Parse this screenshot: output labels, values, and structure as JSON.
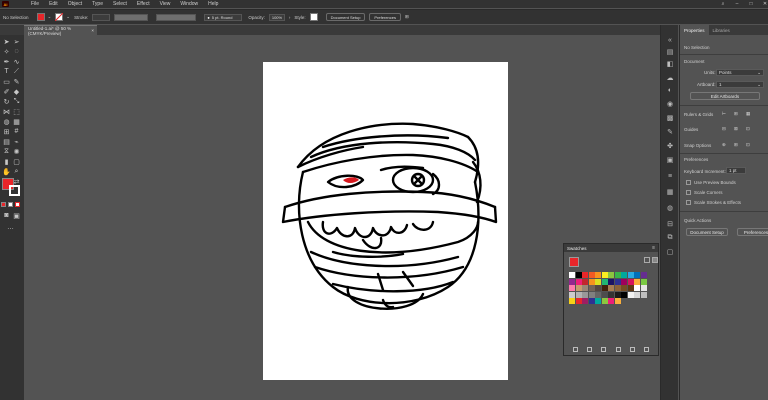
{
  "menubar": {
    "app_icon": "Ai",
    "items": [
      "File",
      "Edit",
      "Object",
      "Type",
      "Select",
      "Effect",
      "View",
      "Window",
      "Help"
    ]
  },
  "controlbar": {
    "selection_label": "No Selection",
    "stroke_label": "Stroke:",
    "brush_value": "5 pt. Round",
    "opacity_label": "Opacity:",
    "opacity_value": "100%",
    "style_label": "Style:",
    "document_setup": "Document Setup",
    "preferences": "Preferences",
    "fill_color": "#e8262a"
  },
  "document": {
    "tab_title": "Untitled-1.ai* @ 50 % (CMYK/Preview)"
  },
  "properties_panel": {
    "tabs": [
      "Properties",
      "Libraries"
    ],
    "no_selection": "No Selection",
    "document_heading": "Document",
    "units_label": "Units:",
    "units_value": "Points",
    "artboard_label": "Artboard:",
    "artboard_value": "1",
    "edit_artboards": "Edit Artboards",
    "rulers_grids": "Rulers & Grids",
    "guides": "Guides",
    "snap_options": "Snap Options",
    "preferences_heading": "Preferences",
    "keyboard_increment_label": "Keyboard Increment:",
    "keyboard_increment_value": "1 pt",
    "checkboxes": [
      "Use Preview Bounds",
      "Scale Corners",
      "Scale Strokes & Effects"
    ],
    "quick_actions": "Quick Actions",
    "document_setup": "Document Setup",
    "preferences_btn": "Preferences"
  },
  "swatches_panel": {
    "title": "Swatches",
    "colors": [
      "#ffffff",
      "#000000",
      "#e8262a",
      "#f15a24",
      "#f7931e",
      "#fcee21",
      "#8cc63f",
      "#39b54a",
      "#00a99d",
      "#29abe2",
      "#0071bc",
      "#662d91",
      "#93278f",
      "#ed1e79",
      "#c1272d",
      "#f7931e",
      "#d9e021",
      "#22b573",
      "#1b1464",
      "#2e3192",
      "#9e005d",
      "#d4145a",
      "#fbb03b",
      "#7ac943",
      "#ff7bac",
      "#c69c6d",
      "#998675",
      "#736357",
      "#534741",
      "#42210b",
      "#a67c52",
      "#8c6239",
      "#754c24",
      "#603813",
      "#ffffff",
      "#e6e6e6",
      "#cccccc",
      "#b3b3b3",
      "#999999",
      "#808080",
      "#666666",
      "#4d4d4d",
      "#333333",
      "#1a1a1a",
      "#000000",
      "#f2f2f2",
      "#d9d9d9",
      "#bfbfbf",
      "#f7d117",
      "#e8262a",
      "#9e1f63",
      "#2e3192",
      "#00a99d",
      "#8cc63f",
      "#ed1e79",
      "#fbb03b"
    ]
  }
}
